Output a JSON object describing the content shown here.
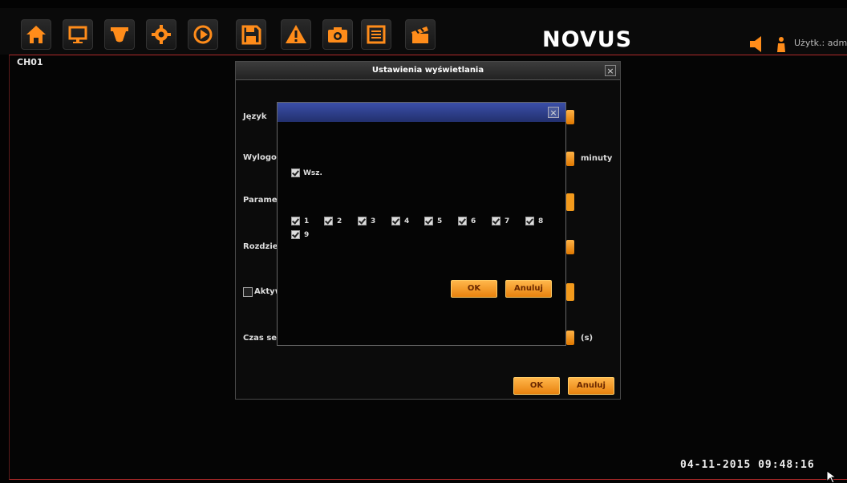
{
  "toolbar": {
    "buttons": [
      "home-icon",
      "monitor-icon",
      "camera-dome-icon",
      "gear-icon",
      "playback-icon",
      "save-icon",
      "alarm-warning-icon",
      "snapshot-camera-icon",
      "list-icon",
      "clapperboard-icon"
    ],
    "accent": "#ff8c1a"
  },
  "brand": {
    "logo": "NOVUS"
  },
  "user": {
    "label": "Użytk.: admi"
  },
  "live": {
    "channel": "CH01",
    "timestamp": "04-11-2015  09:48:16"
  },
  "dialog": {
    "title": "Ustawienia wyświetlania",
    "close": "×",
    "rows": {
      "jezyk": "Język",
      "wylogow": "Wylogow",
      "paramet": "Paramet",
      "rozdzie": "Rozdzie",
      "aktyw": "Aktyw",
      "czas": "Czas sel"
    },
    "units": {
      "minuty": "minuty",
      "seconds": "(s)"
    },
    "ok": "OK",
    "cancel": "Anuluj"
  },
  "subdialog": {
    "close": "×",
    "select_all": "Wsz.",
    "channels": [
      "1",
      "2",
      "3",
      "4",
      "5",
      "6",
      "7",
      "8",
      "9"
    ],
    "ok": "OK",
    "cancel": "Anuluj"
  }
}
